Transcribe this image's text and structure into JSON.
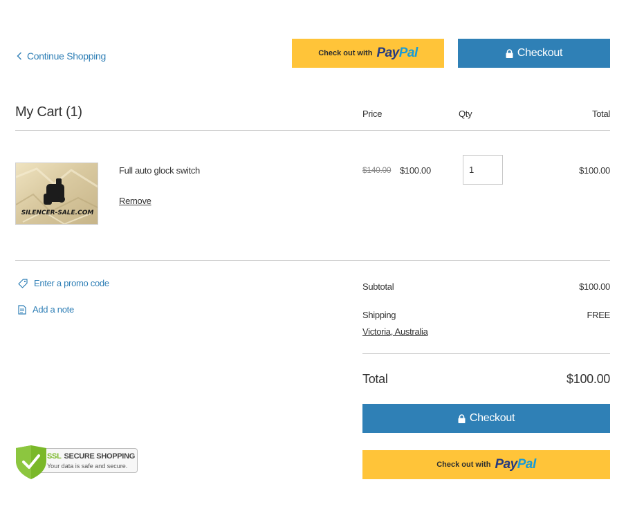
{
  "nav": {
    "continue_label": "Continue Shopping"
  },
  "paypal": {
    "text": "Check out with",
    "logo_pay": "Pay",
    "logo_pal": "Pal"
  },
  "checkout": {
    "label": "Checkout"
  },
  "cart": {
    "title": "My Cart (1)",
    "columns": {
      "price": "Price",
      "qty": "Qty",
      "total": "Total"
    },
    "items": [
      {
        "name": "Full auto glock switch",
        "remove_label": "Remove",
        "old_price": "$140.00",
        "price": "$100.00",
        "qty": "1",
        "total": "$100.00",
        "image_watermark": "SILENCER-SALE.COM"
      }
    ]
  },
  "actions": {
    "promo_label": "Enter a promo code",
    "note_label": "Add a note"
  },
  "summary": {
    "subtotal_label": "Subtotal",
    "subtotal_value": "$100.00",
    "shipping_label": "Shipping",
    "shipping_value": "FREE",
    "shipping_location": "Victoria, Australia",
    "total_label": "Total",
    "total_value": "$100.00"
  },
  "ssl_badge": {
    "ssl": "SSL",
    "title": "SECURE SHOPPING",
    "subtitle": "Your data is safe and secure."
  },
  "colors": {
    "accent_blue": "#2f80b6",
    "link_blue": "#2f7fb6",
    "paypal_yellow": "#ffc439",
    "paypal_dark_blue": "#253b80",
    "paypal_light_blue": "#179bd7",
    "ssl_green": "#7ab829"
  }
}
